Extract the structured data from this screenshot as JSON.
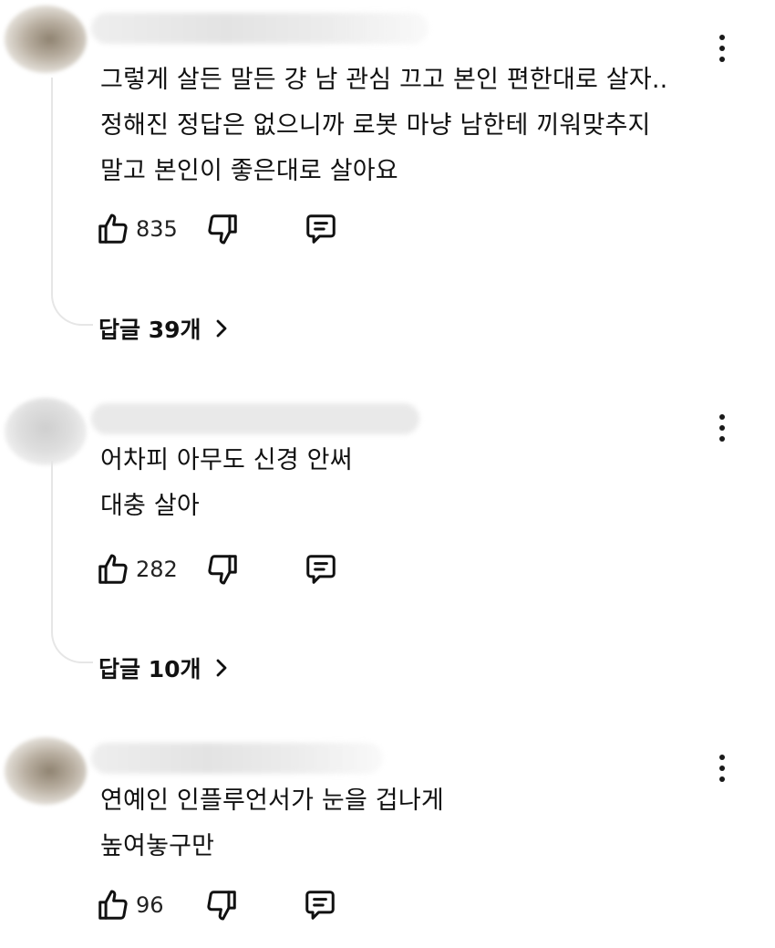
{
  "comments": [
    {
      "text": "그렇게 살든 말든 걍 남 관심 끄고 본인 편한대로 살자..\n정해진 정답은 없으니까 로봇 마냥 남한테 끼워맞추지\n말고 본인이 좋은대로 살아요",
      "likes": "835",
      "replies_label": "답글 39개"
    },
    {
      "text": "어차피 아무도 신경 안써\n대충 살아",
      "likes": "282",
      "replies_label": "답글 10개"
    },
    {
      "text": "연예인 인플루언서가 눈을 겁나게\n높여놓구만",
      "likes": "96"
    }
  ],
  "icons": {
    "like": "thumbs-up-icon",
    "dislike": "thumbs-down-icon",
    "reply": "comment-icon",
    "more": "more-vertical-icon",
    "chevron": "chevron-right-icon"
  }
}
